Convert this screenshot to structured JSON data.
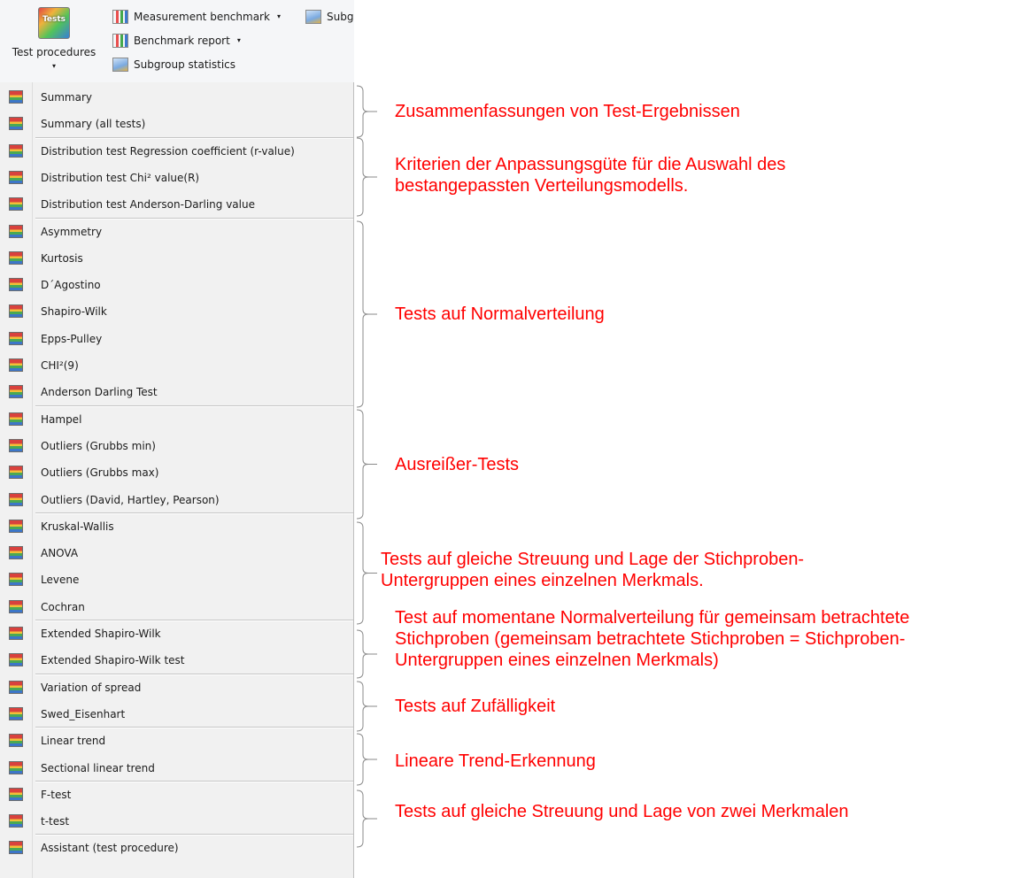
{
  "ribbon": {
    "big_button": {
      "icon_text": "Tests",
      "label": "Test procedures",
      "arrow": "▾"
    },
    "items": [
      {
        "label": "Measurement benchmark",
        "has_dropdown": true,
        "icon": "bar-chart-icon"
      },
      {
        "label": "Subg",
        "has_dropdown": false,
        "icon": "subgroup-stats-icon"
      },
      {
        "label": "Benchmark report",
        "has_dropdown": true,
        "icon": "bar-chart-icon"
      },
      {
        "label": "Subgroup statistics",
        "has_dropdown": false,
        "icon": "subgroup-stats-icon"
      }
    ],
    "dropdown_glyph": "▾"
  },
  "menu": {
    "items": [
      {
        "label": "Summary"
      },
      {
        "label": "Summary (all tests)"
      },
      {
        "label": "Distribution test Regression coefficient (r-value)"
      },
      {
        "label": "Distribution test Chi² value(R)"
      },
      {
        "label": "Distribution test Anderson-Darling value"
      },
      {
        "label": "Asymmetry"
      },
      {
        "label": "Kurtosis"
      },
      {
        "label": "D´Agostino"
      },
      {
        "label": "Shapiro-Wilk"
      },
      {
        "label": "Epps-Pulley"
      },
      {
        "label": "CHI²(9)"
      },
      {
        "label": "Anderson Darling Test"
      },
      {
        "label": "Hampel"
      },
      {
        "label": "Outliers  (Grubbs min)"
      },
      {
        "label": "Outliers  (Grubbs max)"
      },
      {
        "label": "Outliers (David, Hartley, Pearson)"
      },
      {
        "label": "Kruskal-Wallis"
      },
      {
        "label": "ANOVA"
      },
      {
        "label": "Levene"
      },
      {
        "label": "Cochran"
      },
      {
        "label": "Extended Shapiro-Wilk"
      },
      {
        "label": "Extended Shapiro-Wilk test"
      },
      {
        "label": "Variation of spread"
      },
      {
        "label": "Swed_Eisenhart"
      },
      {
        "label": "Linear trend"
      },
      {
        "label": "Sectional linear trend"
      },
      {
        "label": "F-test"
      },
      {
        "label": "t-test"
      },
      {
        "label": "Assistant (test procedure)"
      }
    ]
  },
  "annotations": [
    {
      "lines": [
        "Zusammenfassungen von Test-Ergebnissen"
      ],
      "color": "#ff0000"
    },
    {
      "lines": [
        "Kriterien der Anpassungsgüte für die Auswahl des",
        "bestangepassten Verteilungsmodells."
      ],
      "color": "#ff0000"
    },
    {
      "lines": [
        "Tests auf Normalverteilung"
      ],
      "color": "#ff0000"
    },
    {
      "lines": [
        "Ausreißer-Tests"
      ],
      "color": "#ff0000"
    },
    {
      "lines": [
        "Tests auf gleiche Streuung und Lage der Stichproben-",
        "Untergruppen eines einzelnen Merkmals."
      ],
      "color": "#ff0000"
    },
    {
      "lines": [
        "Test auf momentane Normalverteilung für gemeinsam betrachtete",
        "Stichproben (gemeinsam betrachtete Stichproben = Stichproben-",
        "Untergruppen eines einzelnen Merkmals)"
      ],
      "color": "#ff0000"
    },
    {
      "lines": [
        "Tests auf Zufälligkeit"
      ],
      "color": "#ff0000"
    },
    {
      "lines": [
        "Lineare Trend-Erkennung"
      ],
      "color": "#ff0000"
    },
    {
      "lines": [
        "Tests auf gleiche Streuung und Lage von zwei Merkmalen"
      ],
      "color": "#ff0000"
    }
  ]
}
